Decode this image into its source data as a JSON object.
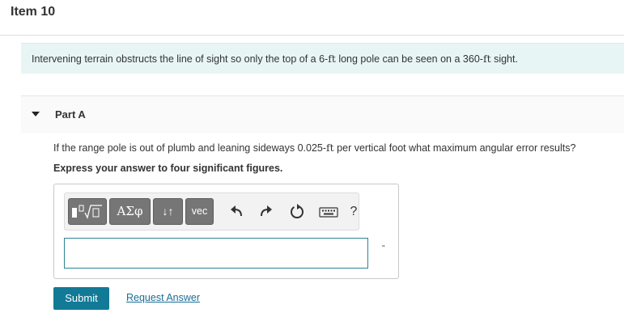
{
  "item": {
    "title": "Item 10"
  },
  "intro": {
    "part1": "Intervening terrain obstructs the line of sight so only the top of a 6-",
    "unit1": "ft",
    "part2": " long pole can be seen on a 360-",
    "unit2": "ft",
    "part3": " sight."
  },
  "part": {
    "label": "Part A"
  },
  "question": {
    "part1": "If the range pole is out of plumb and leaning sideways 0.025-",
    "unit1": "ft",
    "part2": " per vertical foot what maximum angular error results?"
  },
  "instruction": "Express your answer to four significant figures.",
  "toolbar": {
    "templates_label": "",
    "symbols_label": "ΑΣφ",
    "arrows_label": "↓↑",
    "vec_label": "vec",
    "help_label": "?",
    "icons": [
      "templates-icon",
      "undo-icon",
      "redo-icon",
      "reset-icon",
      "keyboard-icon",
      "help-icon"
    ]
  },
  "answer": {
    "value": "",
    "unit": "\""
  },
  "actions": {
    "submit_label": "Submit",
    "request_label": "Request Answer"
  },
  "colors": {
    "accent": "#127a96",
    "link": "#1a6e96",
    "intro_bg": "#e8f5f5",
    "toolbar_button": "#767676"
  }
}
